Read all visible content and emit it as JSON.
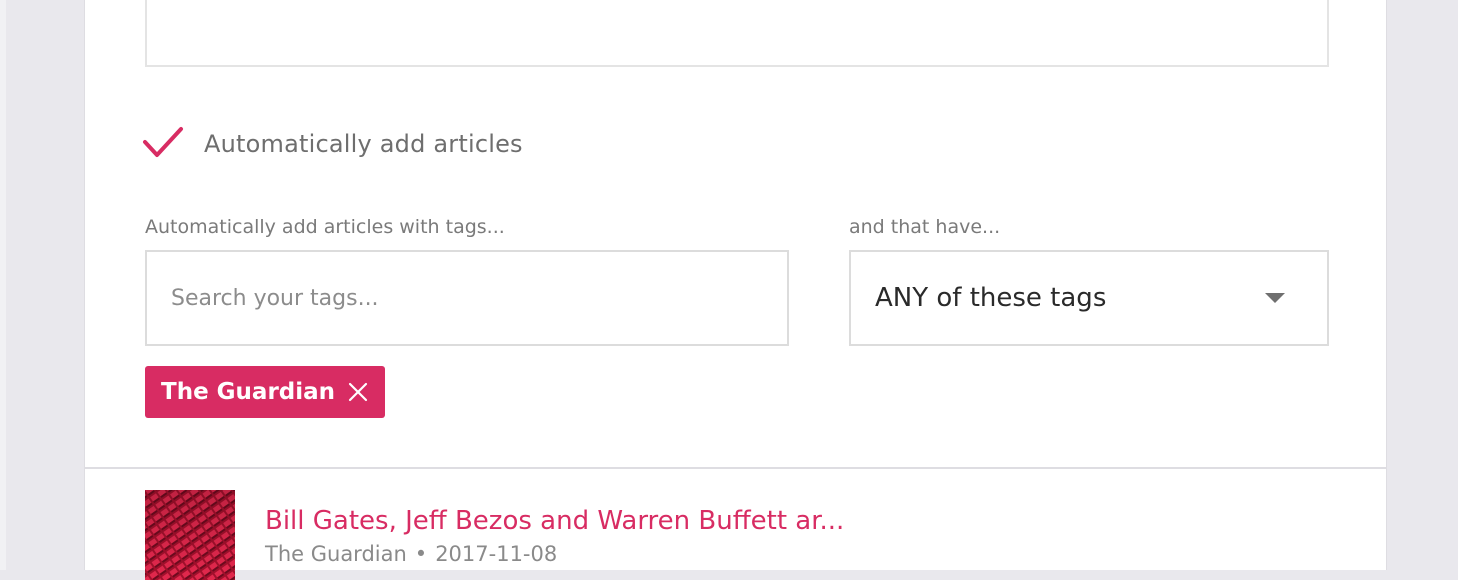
{
  "collection": {
    "description_value": ""
  },
  "auto_add": {
    "checked": true,
    "label": "Automatically add articles",
    "tags_label": "Automatically add articles with tags...",
    "match_label": "and that have...",
    "tag_search_placeholder": "Search your tags...",
    "match_selected": "ANY of these tags",
    "selected_tags": [
      "The Guardian"
    ]
  },
  "articles": [
    {
      "title": "Bill Gates, Jeff Bezos and Warren Buffett ar...",
      "source": "The Guardian",
      "separator": "•",
      "date": "2017-11-08"
    }
  ],
  "colors": {
    "accent": "#d82c63",
    "text_muted": "#7a7a7a",
    "border": "#dcdcdc",
    "page_bg": "#e9e8ed"
  },
  "icons": {
    "checkbox": "check-icon",
    "tag_remove": "close-icon",
    "dropdown": "chevron-down-icon"
  }
}
